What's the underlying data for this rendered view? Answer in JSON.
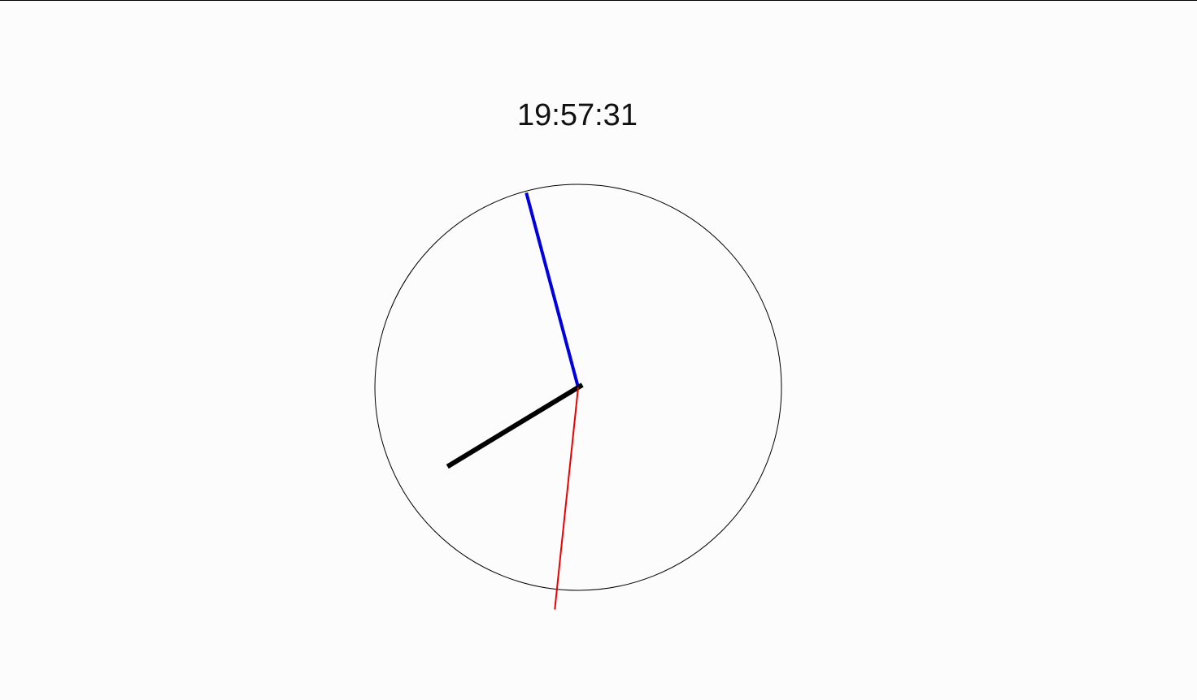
{
  "clock": {
    "time_text": "19:57:31",
    "hours": 19,
    "minutes": 57,
    "seconds": 31,
    "colors": {
      "face_outline": "#000000",
      "hour_hand": "#000000",
      "minute_hand": "#0000dd",
      "second_hand": "#ee0000",
      "background": "#fcfcfc"
    }
  }
}
